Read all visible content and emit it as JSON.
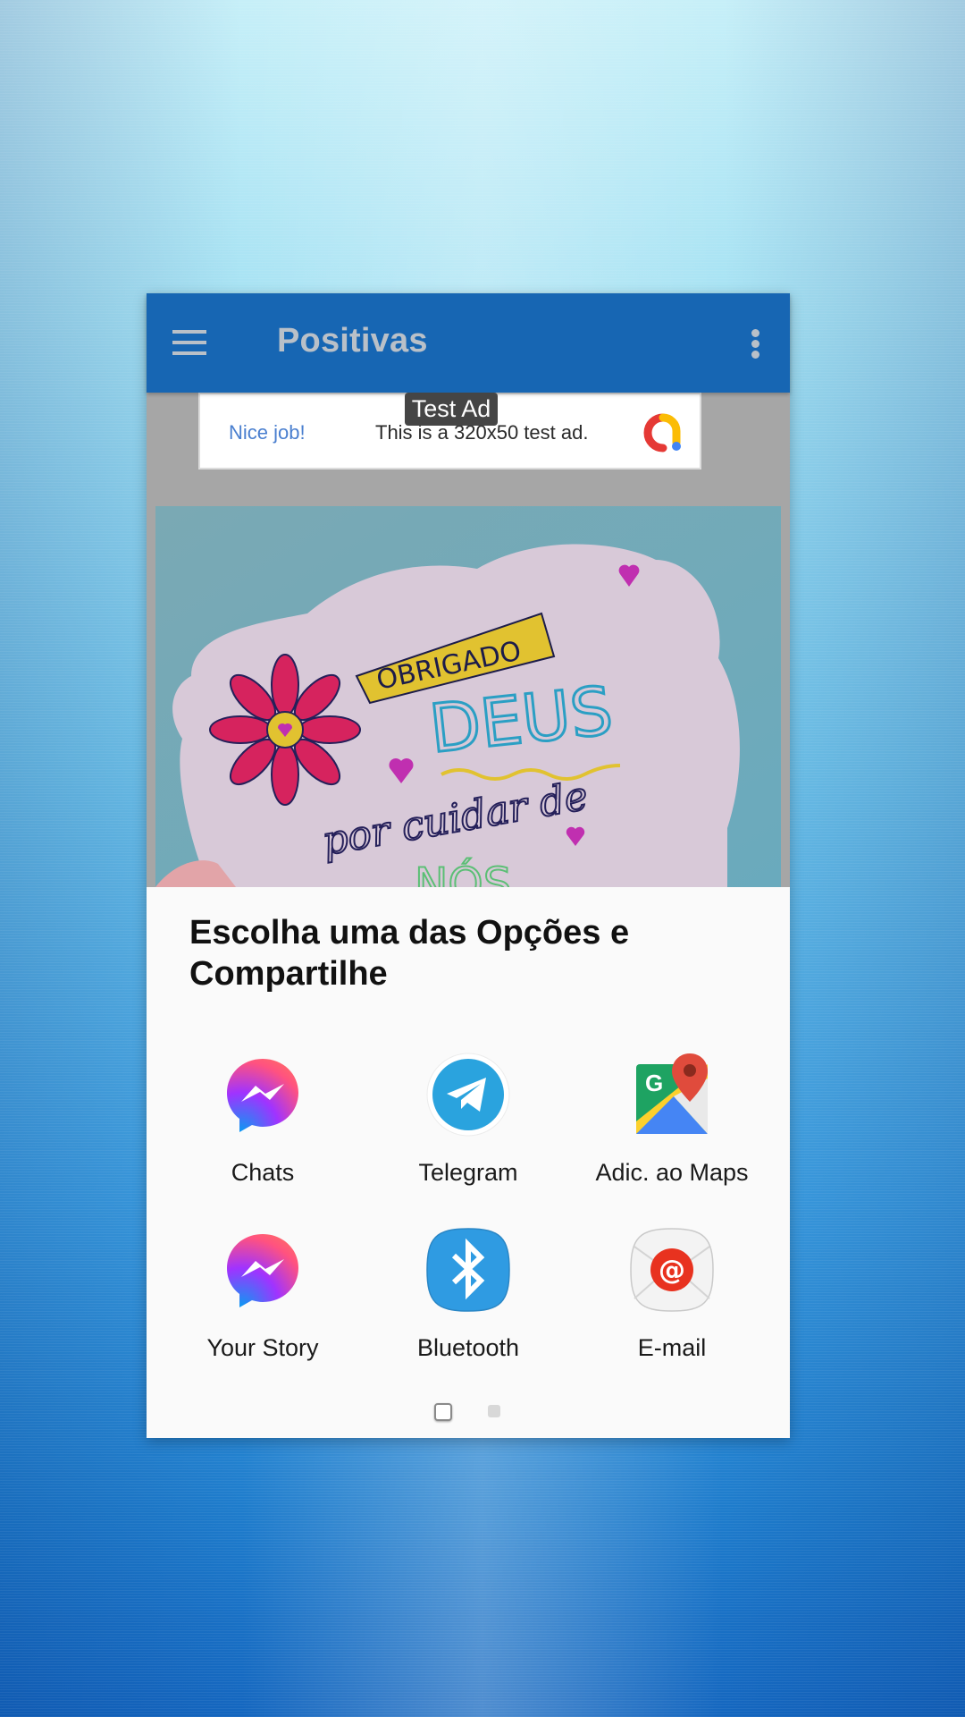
{
  "app": {
    "title": "Positivas",
    "menu_icon": "hamburger-menu-icon",
    "overflow_icon": "more-vertical-icon",
    "colors": {
      "appbar": "#1766b3",
      "title_text": "#b9c0c8",
      "dim_overlay": "#a6a6a6"
    }
  },
  "ad": {
    "badge": "Test Ad",
    "headline": "Nice job!",
    "body": "This is a 320x50 test ad.",
    "logo_icon": "admob-logo-icon"
  },
  "content_image": {
    "description": "Hand-lettered card held against sky",
    "lines": [
      "OBRIGADO",
      "DEUS",
      "por cuidar de",
      "NÓS"
    ]
  },
  "share_sheet": {
    "title": "Escolha uma das Opções e Compartilhe",
    "targets": [
      {
        "label": "Chats",
        "icon": "messenger-icon"
      },
      {
        "label": "Telegram",
        "icon": "telegram-icon"
      },
      {
        "label": "Adic. ao Maps",
        "icon": "google-maps-icon"
      },
      {
        "label": "Your Story",
        "icon": "messenger-icon"
      },
      {
        "label": "Bluetooth",
        "icon": "bluetooth-icon"
      },
      {
        "label": "E-mail",
        "icon": "email-icon"
      }
    ],
    "pages": {
      "current": 1,
      "total": 2
    }
  }
}
